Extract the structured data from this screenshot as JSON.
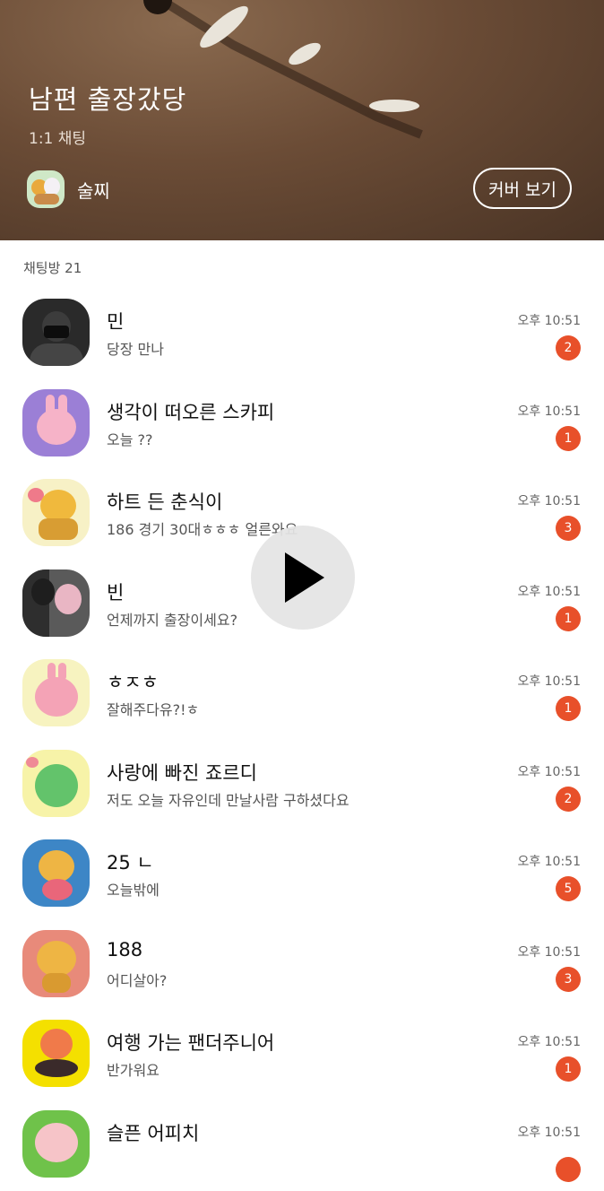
{
  "cover": {
    "title": "남편 출장갔당",
    "subtitle": "1:1 채팅",
    "owner_name": "술찌",
    "button_label": "커버 보기"
  },
  "section": {
    "title": "채팅방 21"
  },
  "colors": {
    "badge": "#e8502a",
    "cover_bg": "#6b4c36"
  },
  "chats": [
    {
      "name": "민",
      "message": "당장 만나",
      "time": "오후 10:51",
      "unread": "2",
      "avatar_icon": "photo-avatar-icon",
      "avatar_bg": "#2a2a2a"
    },
    {
      "name": "생각이 떠오른 스카피",
      "message": "오늘 ??",
      "time": "오후 10:51",
      "unread": "1",
      "avatar_icon": "pink-rabbit-icon",
      "avatar_bg": "#9b7fd6"
    },
    {
      "name": "하트 든 춘식이",
      "message": "186 경기 30대ㅎㅎㅎ 얼른와요",
      "time": "오후 10:51",
      "unread": "3",
      "avatar_icon": "yellow-cat-heart-icon",
      "avatar_bg": "#f7f1c6"
    },
    {
      "name": "빈",
      "message": "언제까지 출장이세요?",
      "time": "오후 10:51",
      "unread": "1",
      "avatar_icon": "photo-avatar-icon",
      "avatar_bg": "#5a5a5a"
    },
    {
      "name": "ㅎㅈㅎ",
      "message": "잘해주다유?!ㅎ",
      "time": "오후 10:51",
      "unread": "1",
      "avatar_icon": "pink-rabbit-icon",
      "avatar_bg": "#f7f3c0"
    },
    {
      "name": "사랑에 빠진 죠르디",
      "message": "저도 오늘 자유인데 만날사람 구하셨다요",
      "time": "오후 10:51",
      "unread": "2",
      "avatar_icon": "green-dino-icon",
      "avatar_bg": "#f7f3a8"
    },
    {
      "name": "25 ㄴ",
      "message": "오늘밖에",
      "time": "오후 10:51",
      "unread": "5",
      "avatar_icon": "ryan-heart-icon",
      "avatar_bg": "#3d86c6"
    },
    {
      "name": "188",
      "message": "어디살아?",
      "time": "오후 10:51",
      "unread": "3",
      "avatar_icon": "ryan-crying-icon",
      "avatar_bg": "#e88a7a"
    },
    {
      "name": "여행 가는 팬더주니어",
      "message": "반가워요",
      "time": "오후 10:51",
      "unread": "1",
      "avatar_icon": "panda-junior-icon",
      "avatar_bg": "#f4e000"
    },
    {
      "name": "슬픈 어피치",
      "message": "",
      "time": "오후 10:51",
      "unread": "",
      "avatar_icon": "apeach-icon",
      "avatar_bg": "#6fc24a"
    }
  ]
}
